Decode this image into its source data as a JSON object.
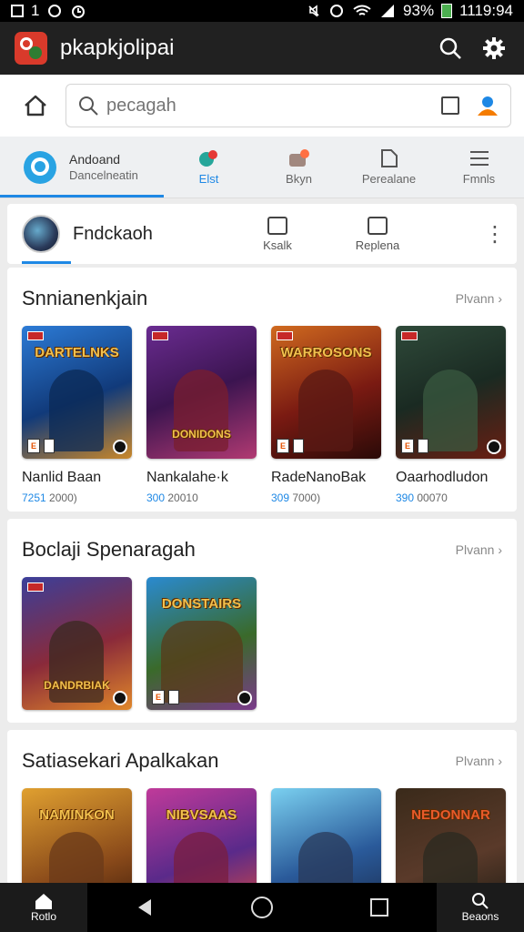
{
  "status_bar": {
    "left": "1",
    "right": "93%",
    "time": "1119:94"
  },
  "app": {
    "title": "pkapkjolipai"
  },
  "search": {
    "placeholder": "pecagah"
  },
  "tabs": [
    {
      "line1": "Andoand",
      "line2": "Dancelneatin"
    },
    {
      "label": "Elst"
    },
    {
      "label": "Bkyn"
    },
    {
      "label": "Perealane"
    },
    {
      "label": "Fmnls"
    }
  ],
  "profile": {
    "name": "Fndckaoh",
    "action1": "Ksalk",
    "action2": "Replena"
  },
  "sections": [
    {
      "title": "Snnianenkjain",
      "more": "Plvann",
      "cards": [
        {
          "cover_title": "DARTELNKS",
          "name": "Nanlid Baan",
          "meta_a": "7251",
          "meta_b": "2000)"
        },
        {
          "cover_title": "DONIDONS",
          "name": "Nankalahe·k",
          "meta_a": "300",
          "meta_b": "20010"
        },
        {
          "cover_title": "WARROSONS",
          "name": "RadeNanoBak",
          "meta_a": "309",
          "meta_b": "7000)"
        },
        {
          "cover_title": "",
          "name": "Oaarhodludon",
          "meta_a": "390",
          "meta_b": "00070"
        }
      ]
    },
    {
      "title": "Boclaji Spenaragah",
      "more": "Plvann",
      "cards": [
        {
          "cover_title": "DANDRBIAK",
          "name": "",
          "meta_a": "",
          "meta_b": ""
        },
        {
          "cover_title": "DONSTAIRS",
          "name": "",
          "meta_a": "",
          "meta_b": ""
        }
      ]
    },
    {
      "title": "Satiasekari Apalkakan",
      "more": "Plvann",
      "cards": [
        {
          "cover_title": "NAMINKON",
          "name": "",
          "meta_a": "",
          "meta_b": ""
        },
        {
          "cover_title": "NIBVSAAS",
          "name": "",
          "meta_a": "",
          "meta_b": ""
        },
        {
          "cover_title": "",
          "name": "",
          "meta_a": "",
          "meta_b": ""
        },
        {
          "cover_title": "NEDONNAR",
          "name": "",
          "meta_a": "",
          "meta_b": ""
        }
      ]
    }
  ],
  "nav": {
    "left_label": "Rotlo",
    "right_label": "Beaons"
  },
  "colors": {
    "accent": "#1e88e5",
    "appbar": "#212121"
  }
}
